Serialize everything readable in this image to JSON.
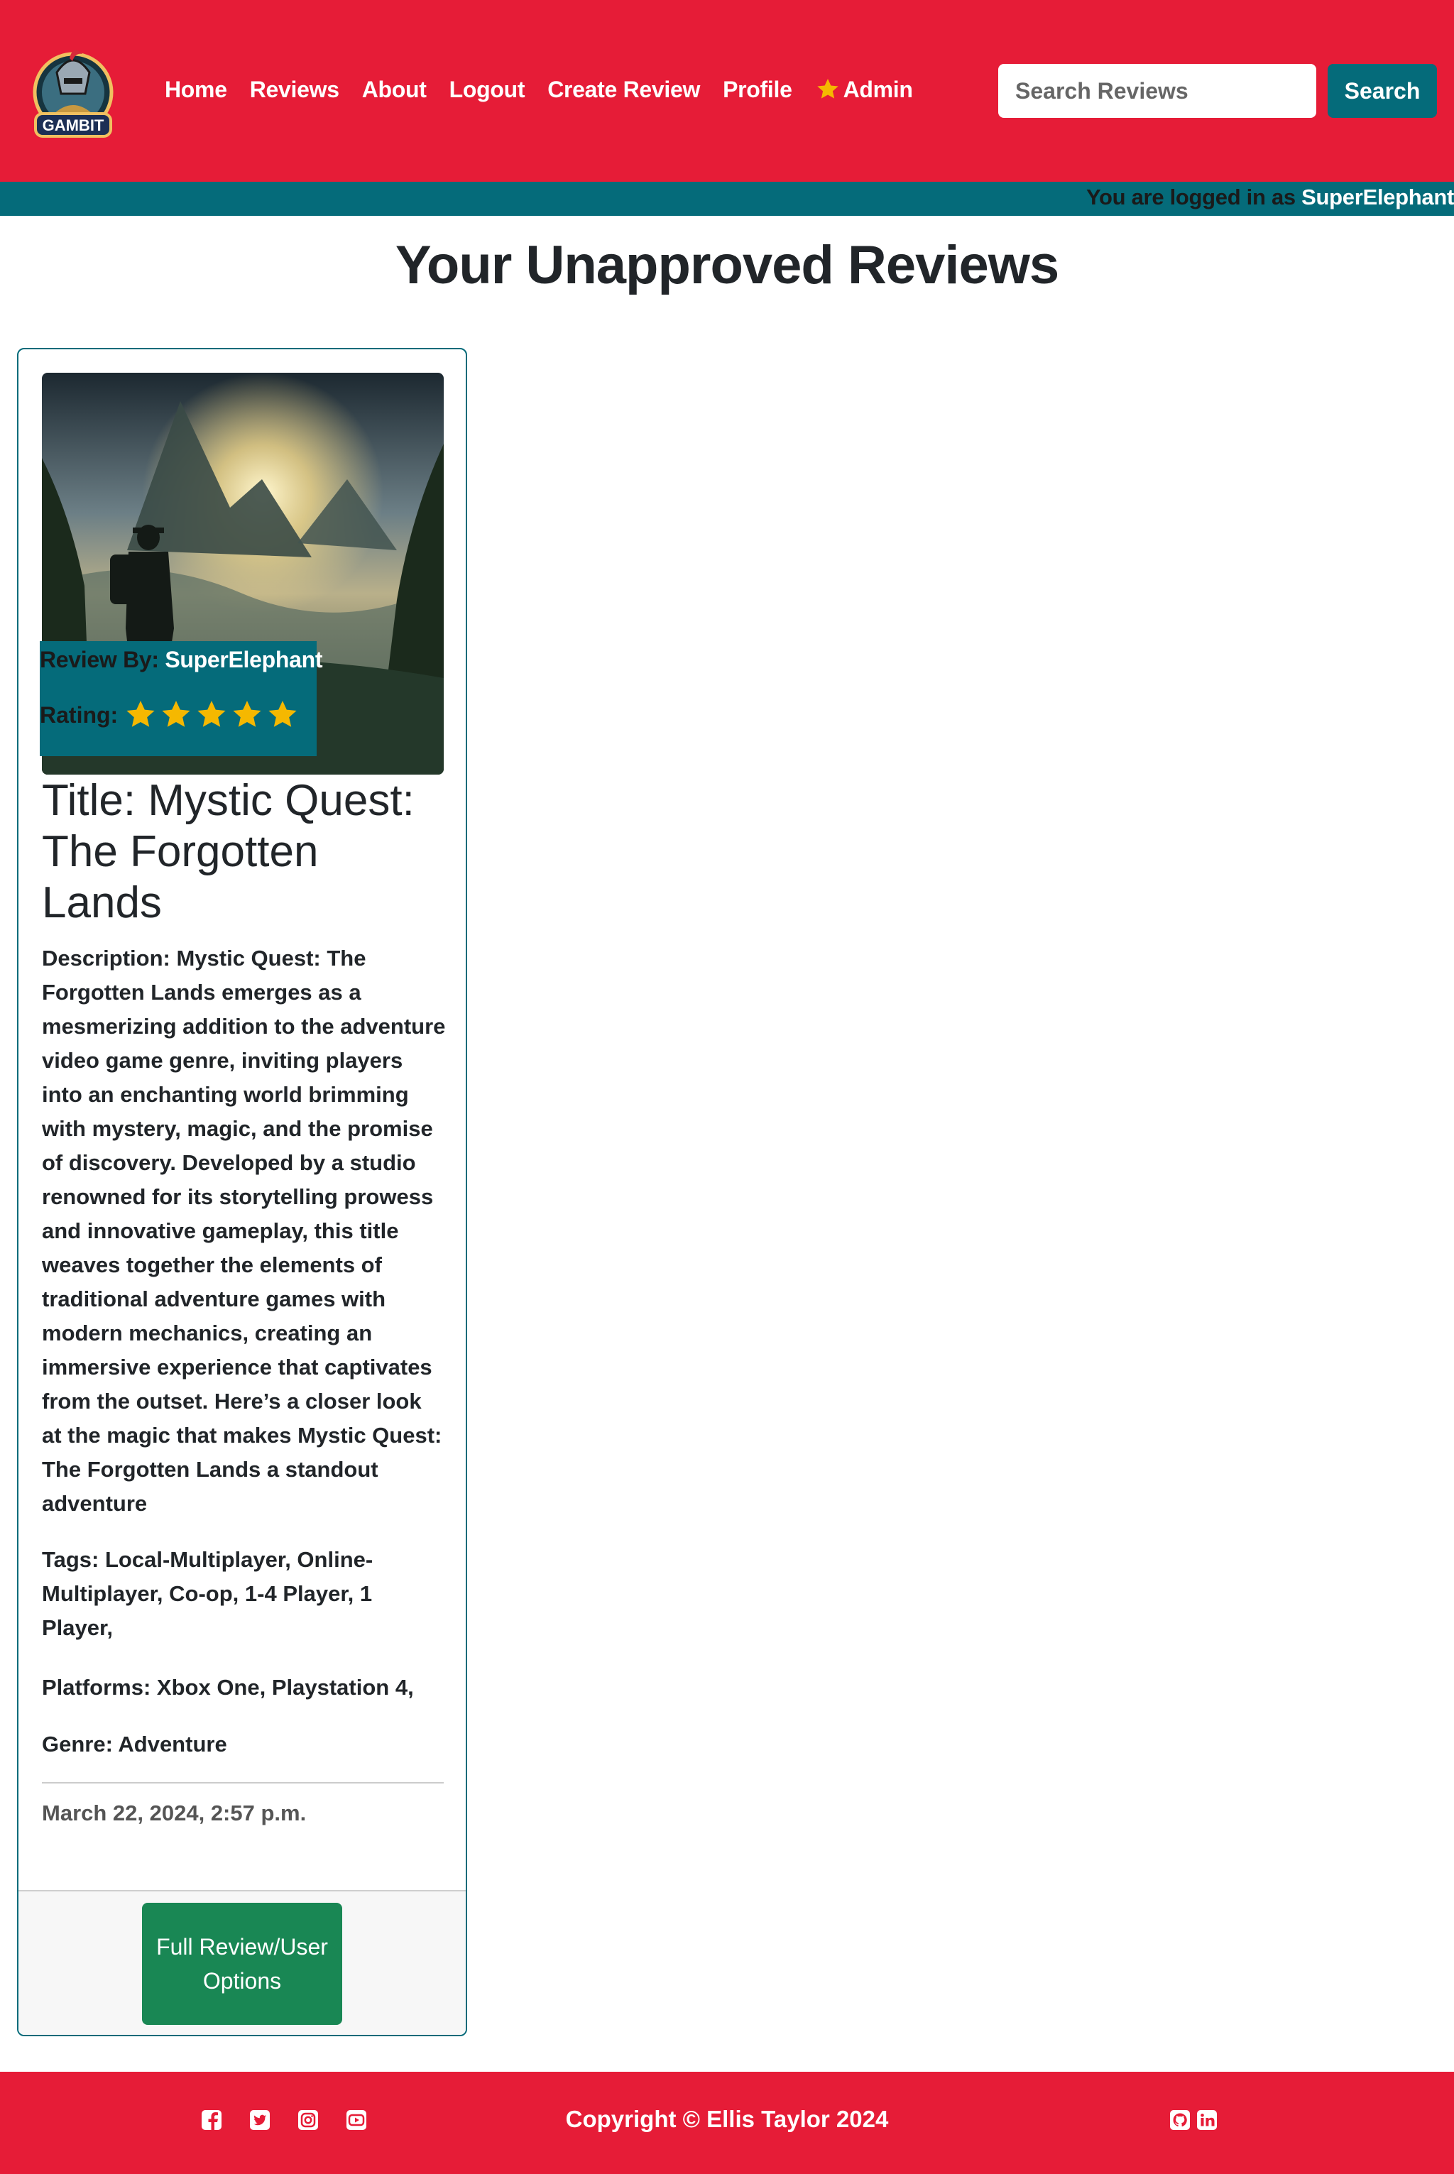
{
  "brand": {
    "logo_text": "GAMBIT"
  },
  "nav": {
    "items": [
      "Home",
      "Reviews",
      "About",
      "Logout",
      "Create Review",
      "Profile"
    ],
    "admin_label": "Admin",
    "search_placeholder": "Search Reviews",
    "search_button": "Search"
  },
  "status": {
    "prefix": "You are logged in as ",
    "username": "SuperElephant"
  },
  "page": {
    "title": "Your Unapproved Reviews"
  },
  "review": {
    "review_by_label": "Review By: ",
    "author": "SuperElephant",
    "rating_label": "Rating:",
    "rating": 5,
    "title": "Title: Mystic Quest: The Forgotten Lands",
    "description": "Description: Mystic Quest: The Forgotten Lands emerges as a mesmerizing addition to the adventure video game genre, inviting players into an enchanting world brimming with mystery, magic, and the promise of discovery. Developed by a studio renowned for its storytelling prowess and innovative gameplay, this title weaves together the elements of traditional adventure games with modern mechanics, creating an immersive experience that captivates from the outset. Here’s a closer look at the magic that makes Mystic Quest: The Forgotten Lands a standout adventure",
    "tags": "Tags: Local-Multiplayer, Online-Multiplayer, Co-op, 1-4 Player, 1 Player,",
    "platforms": "Platforms: Xbox One, Playstation 4,",
    "genre": "Genre: Adventure",
    "date": "March 22, 2024, 2:57 p.m.",
    "button_label": "Full Review/User Options"
  },
  "footer": {
    "copyright": "Copyright © Ellis Taylor 2024",
    "social_icons": [
      "facebook-icon",
      "twitter-icon",
      "instagram-icon",
      "youtube-icon"
    ],
    "dev_icons": [
      "github-icon",
      "linkedin-icon"
    ]
  },
  "colors": {
    "primary_red": "#e61c37",
    "teal": "#056b7a",
    "success_green": "#198754",
    "star_gold": "#f5b800"
  }
}
